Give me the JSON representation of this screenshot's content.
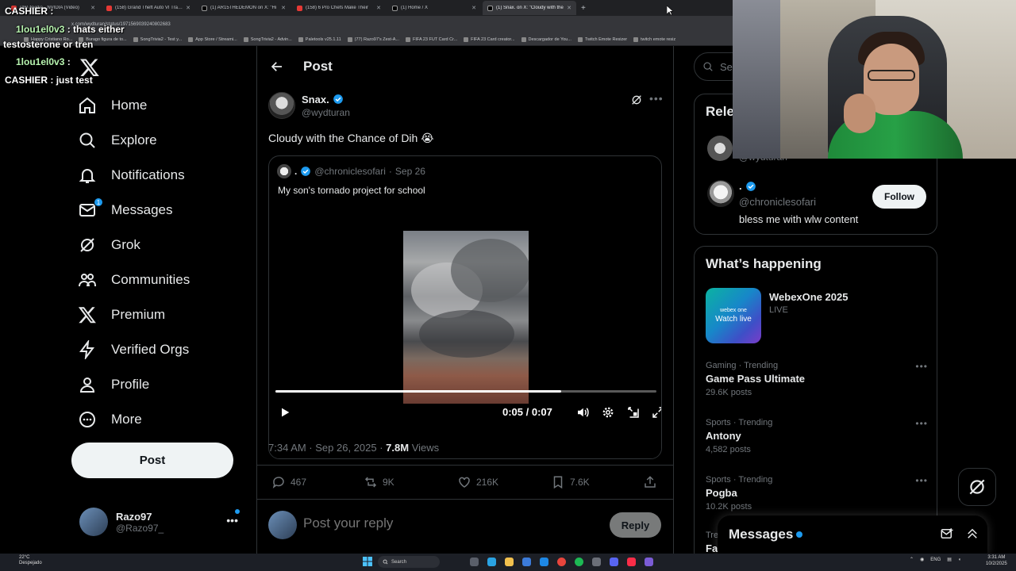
{
  "browser": {
    "tabs": [
      {
        "title": "(46) Nvidia - NVIDIA (Video)",
        "icon": "youtube-icon",
        "active": false
      },
      {
        "title": "(158) Grand Theft Auto VI Trailer",
        "icon": "youtube-icon",
        "active": false
      },
      {
        "title": "(1) AR15THEDEMON on X: \"Hi",
        "icon": "x-icon",
        "active": false
      },
      {
        "title": "(158) 6 Pro Chefs Make Their",
        "icon": "youtube-icon",
        "active": false
      },
      {
        "title": "(1) Home / X",
        "icon": "x-icon",
        "active": false
      },
      {
        "title": "(1) Snax. on X: \"Cloudy with the",
        "icon": "x-icon",
        "active": true
      }
    ],
    "url": "x.com/wydturan/status/1971569039240802683",
    "bookmarks": [
      "Happy Cristiano Ro...",
      "Burago figura de to...",
      "SongTrivia2 - Test y...",
      "App Store / Streami...",
      "SongTrivia2 - Advin...",
      "Paletools v25.1.11",
      "(77) Razo97's Zest-A...",
      "FIFA 23 FUT Card Cr...",
      "FIFA 23 Card creator...",
      "Descargador de You...",
      "Twitch Emote Resizer",
      "twitch emote resiz"
    ]
  },
  "chat": [
    {
      "user": "CASHIER",
      "message": "",
      "color": "#ffffff"
    },
    {
      "user": "1lou1el0v3",
      "message": "thats either",
      "color": "#b8f5b0"
    },
    {
      "user": "",
      "message": "testosterone or tren",
      "color": "#ffffff"
    },
    {
      "user": "1lou1el0v3",
      "message": "",
      "color": "#b8f5b0"
    },
    {
      "user": "CASHIER",
      "message": "just test",
      "color": "#ffffff"
    }
  ],
  "sidebar": {
    "items": [
      {
        "label": "Home",
        "icon": "home-icon"
      },
      {
        "label": "Explore",
        "icon": "search-icon"
      },
      {
        "label": "Notifications",
        "icon": "bell-icon"
      },
      {
        "label": "Messages",
        "icon": "mail-icon",
        "badge": "1"
      },
      {
        "label": "Grok",
        "icon": "grok-icon"
      },
      {
        "label": "Communities",
        "icon": "communities-icon"
      },
      {
        "label": "Premium",
        "icon": "x-logo-icon"
      },
      {
        "label": "Verified Orgs",
        "icon": "lightning-icon"
      },
      {
        "label": "Profile",
        "icon": "person-icon"
      },
      {
        "label": "More",
        "icon": "more-circle-icon"
      }
    ],
    "post_label": "Post",
    "account": {
      "name": "Razo97",
      "handle": "@Razo97_"
    }
  },
  "post": {
    "header_title": "Post",
    "author_name": "Snax.",
    "author_handle": "@wydturan",
    "text": "Cloudy with the Chance of Dih 😭",
    "quote": {
      "name": ".",
      "handle": "@chroniclesofari",
      "date": "Sep 26",
      "text": "My son's tornado project for school"
    },
    "video": {
      "time": "0:05 / 0:07",
      "progress": 0.75
    },
    "timestamp": "7:34 AM · Sep 26, 2025 · ",
    "views_count": "7.8M",
    "views_label": "Views",
    "stats": {
      "replies": "467",
      "reposts": "9K",
      "likes": "216K",
      "bookmarks": "7.6K"
    },
    "reply_placeholder": "Post your reply",
    "reply_button": "Reply"
  },
  "right": {
    "search_placeholder": "Sea",
    "relevant_title": "Rele",
    "relevant_partial_handle": "@wydturan",
    "relevant_user": {
      "name": ".",
      "handle": "@chroniclesofari",
      "bio": "bless me with wlw content",
      "follow_label": "Follow"
    },
    "happening_title": "What’s happening",
    "event": {
      "name": "WebexOne 2025",
      "status": "LIVE",
      "brand": "webex one",
      "watch": "Watch live"
    },
    "trends": [
      {
        "category": "Gaming · Trending",
        "name": "Game Pass Ultimate",
        "posts": "29.6K posts"
      },
      {
        "category": "Sports · Trending",
        "name": "Antony",
        "posts": "4,582 posts"
      },
      {
        "category": "Sports · Trending",
        "name": "Pogba",
        "posts": "10.2K posts"
      },
      {
        "category": "Tre",
        "name": "Fa",
        "posts": ""
      }
    ],
    "messages_title": "Messages"
  },
  "taskbar": {
    "weather_temp": "22°C",
    "weather_desc": "Despejado",
    "search_label": "Search",
    "lang": "ENG",
    "time": "3:31 AM",
    "date": "10/2/2025"
  }
}
